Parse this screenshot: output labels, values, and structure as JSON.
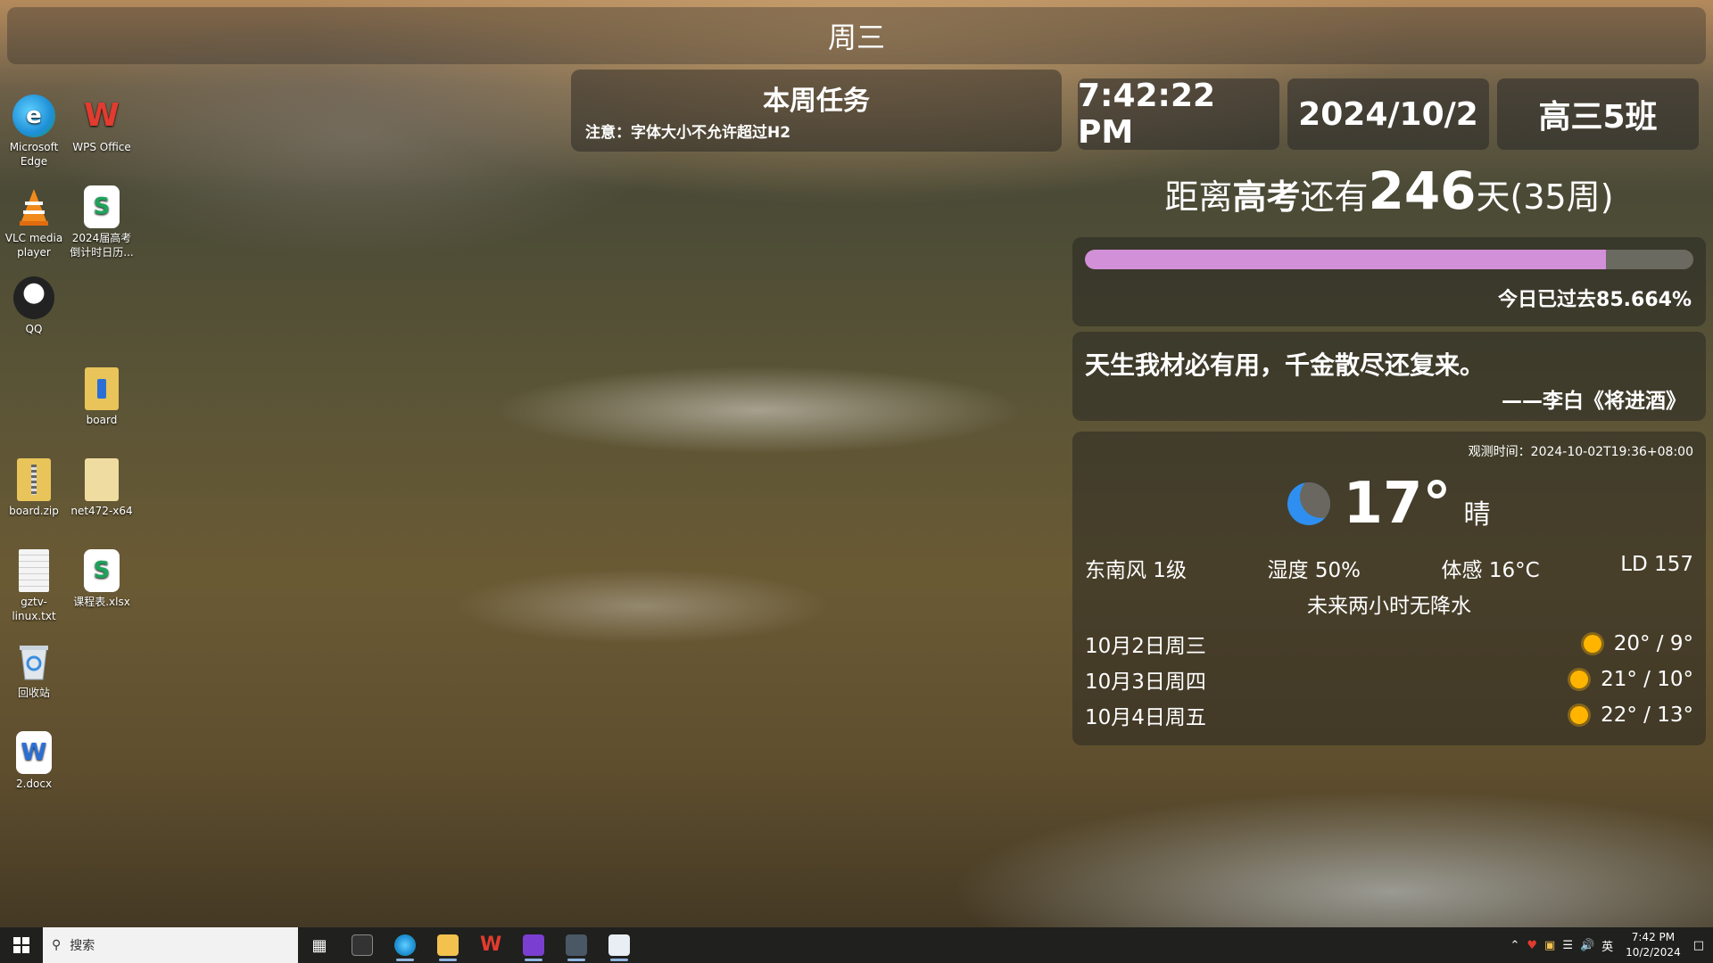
{
  "top_bar": {
    "weekday": "周三"
  },
  "desktop": {
    "icons": [
      {
        "label": "Microsoft Edge",
        "icon": "edge-icon",
        "color": "#1e8fd6"
      },
      {
        "label": "WPS Office",
        "icon": "wps-icon",
        "color": "#d83a2e"
      },
      {
        "label": "VLC media player",
        "icon": "vlc-icon",
        "color": "#f08a1c"
      },
      {
        "label": "2024届高考倒计时日历...",
        "icon": "spreadsheet-icon",
        "color": "#1da35a"
      },
      {
        "label": "QQ",
        "icon": "qq-icon",
        "color": "#222222"
      },
      {
        "label": "board",
        "icon": "folder-icon",
        "color": "#e8c45a"
      },
      {
        "label": "board.zip",
        "icon": "zip-folder-icon",
        "color": "#e8c45a"
      },
      {
        "label": "net472-x64",
        "icon": "folder-icon",
        "color": "#e8c45a"
      },
      {
        "label": "gztv-linux.txt",
        "icon": "text-file-icon",
        "color": "#f2f2f2"
      },
      {
        "label": "课程表.xlsx",
        "icon": "spreadsheet-icon",
        "color": "#1da35a"
      },
      {
        "label": "回收站",
        "icon": "recycle-bin-icon",
        "color": "#dfe6ec"
      },
      {
        "label": "2.docx",
        "icon": "word-doc-icon",
        "color": "#2b6fd6"
      }
    ]
  },
  "tasks": {
    "title": "本周任务",
    "note": "注意：字体大小不允许超过H2"
  },
  "tiles": {
    "time": "7:42:22 PM",
    "date": "2024/10/2",
    "class_name": "高三5班"
  },
  "countdown": {
    "prefix": "距离",
    "event": "高考",
    "mid": "还有",
    "days": "246",
    "suffix": "天(35周)"
  },
  "progress": {
    "percent": 85.664,
    "label": "今日已过去85.664%",
    "color": "#d290d8"
  },
  "quote": {
    "text": "天生我材必有用，千金散尽还复来。",
    "author": "——李白《将进酒》"
  },
  "weather": {
    "observed": "观测时间：2024-10-02T19:36+08:00",
    "icon": "moon-icon",
    "temp": "17°",
    "condition": "晴",
    "wind": "东南风 1级",
    "humidity": "湿度 50%",
    "feels_like": "体感 16°C",
    "ld": "LD 157",
    "precipitation": "未来两小时无降水",
    "forecast": [
      {
        "day": "10月2日周三",
        "icon": "sun-icon",
        "range": "20° / 9°"
      },
      {
        "day": "10月3日周四",
        "icon": "sun-icon",
        "range": "21° / 10°"
      },
      {
        "day": "10月4日周五",
        "icon": "sun-icon",
        "range": "22° / 13°"
      }
    ]
  },
  "taskbar": {
    "search_placeholder": "搜索",
    "ime": "英",
    "clock_time": "7:42 PM",
    "clock_date": "10/2/2024"
  }
}
